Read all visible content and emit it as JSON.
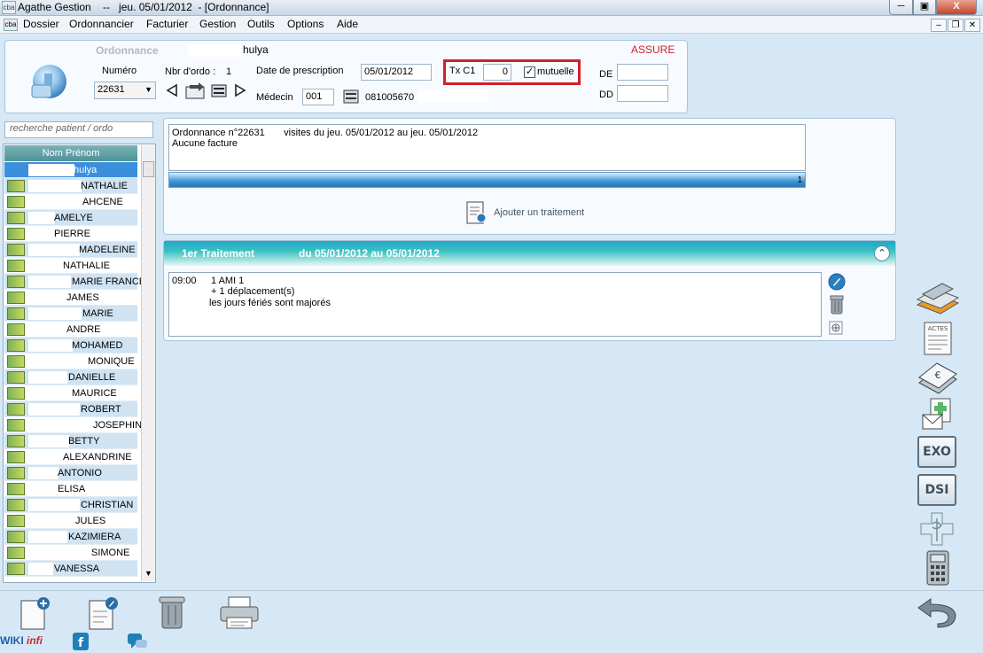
{
  "window": {
    "app_icon_text": "cba",
    "title": "Agathe Gestion    --   jeu. 05/01/2012  - [Ordonnance]",
    "close_label": "X"
  },
  "menu": [
    "Dossier",
    "Ordonnancier",
    "Facturier",
    "Gestion",
    "Outils",
    "Options",
    "Aide"
  ],
  "header": {
    "ordonnance_label": "Ordonnance",
    "patient_name": "hulya",
    "assure_label": "ASSURE",
    "numero_label": "Numéro",
    "numero_value": "22631",
    "nbr_ordo_label": "Nbr d'ordo :",
    "nbr_ordo_value": "1",
    "date_prescription_label": "Date de prescription",
    "date_prescription_value": "05/01/2012",
    "tx_label": "Tx C1",
    "tx_value": "0",
    "mutuelle_label": "mutuelle",
    "mutuelle_checked": true,
    "de_label": "DE",
    "dd_label": "DD",
    "medecin_label": "Médecin",
    "medecin_code": "001",
    "medecin_number": "081005670",
    "highlight_color": "#d0202a",
    "assure_color": "#d0202a"
  },
  "search": {
    "placeholder": "recherche patient / ordo"
  },
  "patient_list": {
    "header": "Nom Prénom",
    "items": [
      "hulya",
      "NATHALIE",
      "AHCENE",
      "AMELYE",
      "PIERRE",
      "MADELEINE",
      "NATHALIE",
      "MARIE FRANCE",
      "JAMES",
      "MARIE",
      "ANDRE",
      "MOHAMED",
      "MONIQUE",
      "DANIELLE",
      "MAURICE",
      "ROBERT",
      "JOSEPHIN",
      "BETTY",
      "ALEXANDRINE",
      "ANTONIO",
      "ELISA",
      "CHRISTIAN",
      "JULES",
      "KAZIMIERA",
      "SIMONE",
      "VANESSA"
    ]
  },
  "ordonnance": {
    "line1_num": "Ordonnance n°22631",
    "line1_visits": "visites du jeu. 05/01/2012 au jeu. 05/01/2012",
    "line2": "Aucune facture",
    "bar_count": "1",
    "add_treatment_label": "Ajouter un traitement"
  },
  "treatment": {
    "title": "1er Traitement",
    "period": "du 05/01/2012 au 05/01/2012",
    "time": "09:00",
    "act": "1 AMI 1",
    "displacement": "+ 1 déplacement(s)",
    "note": "les jours fériés sont majorés"
  },
  "side_buttons": {
    "actes_label": "ACTES",
    "exo_label": "EXO",
    "dsi_label": "DSI"
  },
  "footer": {
    "wiki_part1": "WIKI",
    "wiki_part2": "infi"
  }
}
